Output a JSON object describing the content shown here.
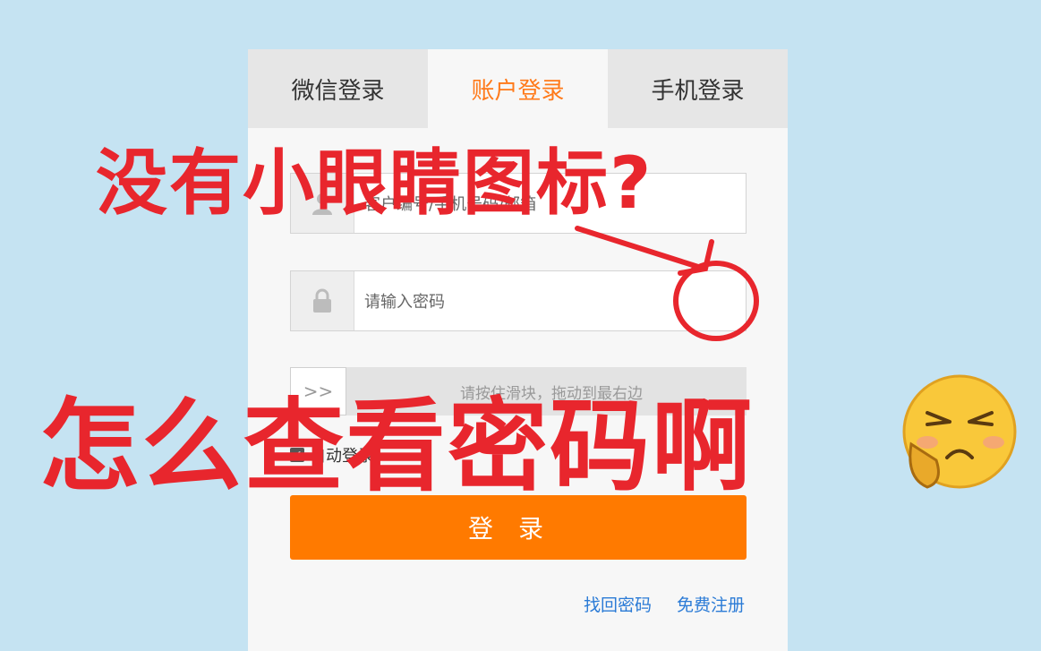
{
  "tabs": [
    {
      "label": "微信登录",
      "active": false
    },
    {
      "label": "账户登录",
      "active": true
    },
    {
      "label": "手机登录",
      "active": false
    }
  ],
  "account_field": {
    "placeholder": "客户编号/手机号码/邮箱",
    "icon": "user-icon"
  },
  "password_field": {
    "placeholder": "请输入密码",
    "icon": "lock-icon"
  },
  "slider": {
    "handle": ">>",
    "hint": "请按住滑块，拖动到最右边"
  },
  "remember": {
    "label": "自动登录",
    "checked": true
  },
  "login_button": "登录",
  "links": {
    "forgot": "找回密码",
    "register": "免费注册"
  },
  "overlay": {
    "line1": "没有小眼睛图标?",
    "line2": "怎么查看密码啊"
  },
  "colors": {
    "accent": "#ff7a00",
    "tab_active": "#ff7a1a",
    "overlay_red": "#e8262d",
    "link": "#2b7bd6",
    "background": "#c5e3f2"
  }
}
